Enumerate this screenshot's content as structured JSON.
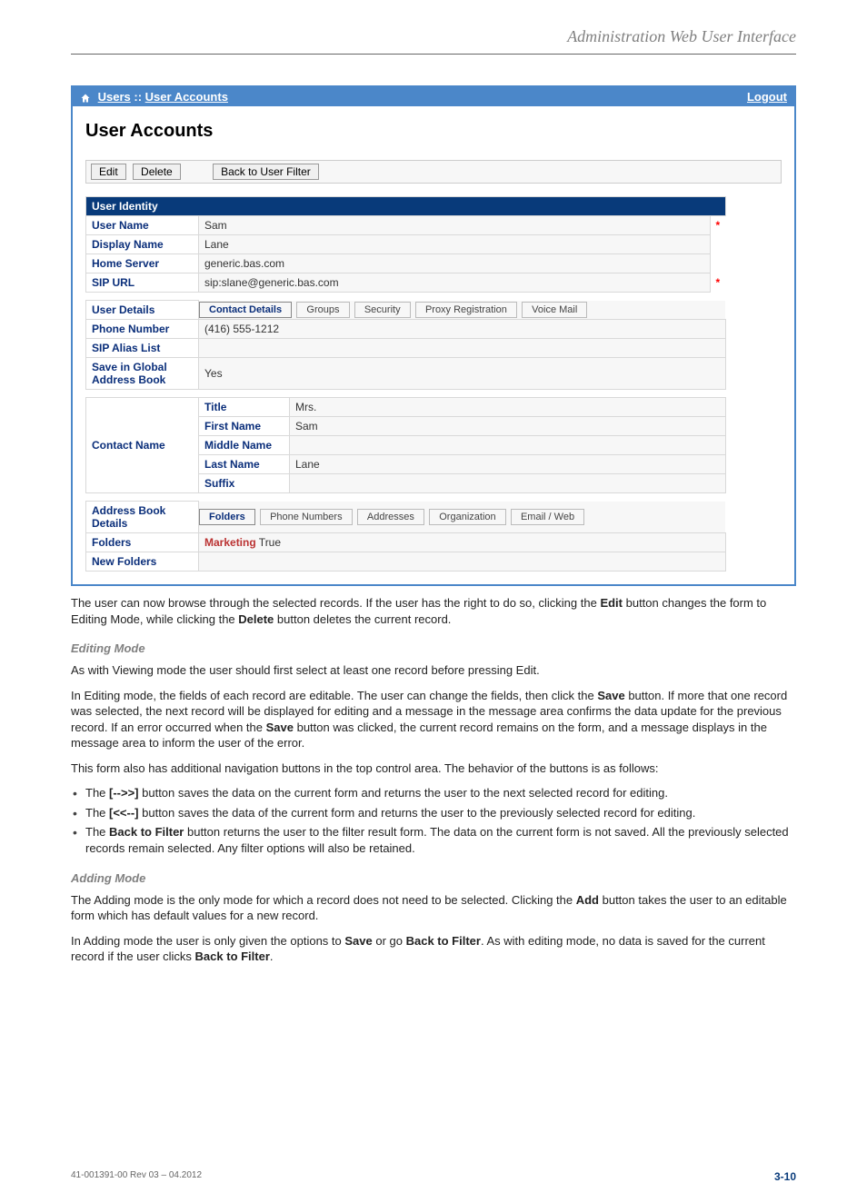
{
  "header": {
    "title": "Administration Web User Interface"
  },
  "breadcrumb": {
    "users_link": "Users",
    "sep": " :: ",
    "accounts_link": "User Accounts",
    "logout": "Logout"
  },
  "page_title": "User Accounts",
  "toolbar": {
    "edit": "Edit",
    "delete": "Delete",
    "back": "Back to User Filter"
  },
  "identity": {
    "section": "User Identity",
    "username_label": "User Name",
    "username": "Sam",
    "display_label": "Display Name",
    "display": "Lane",
    "home_label": "Home Server",
    "home": "generic.bas.com",
    "sip_label": "SIP URL",
    "sip": "sip:slane@generic.bas.com",
    "req": "*"
  },
  "details": {
    "label": "User Details",
    "tabs": {
      "contact": "Contact Details",
      "groups": "Groups",
      "security": "Security",
      "proxy": "Proxy Registration",
      "voicemail": "Voice Mail"
    },
    "phone_label": "Phone Number",
    "phone": "(416) 555-1212",
    "alias_label": "SIP Alias List",
    "save_label": "Save in Global Address Book",
    "save_val": "Yes",
    "contact_label": "Contact Name",
    "title_label": "Title",
    "title_val": "Mrs.",
    "first_label": "First Name",
    "first_val": "Sam",
    "middle_label": "Middle Name",
    "middle_val": "",
    "last_label": "Last Name",
    "last_val": "Lane",
    "suffix_label": "Suffix",
    "suffix_val": ""
  },
  "address": {
    "label": "Address Book Details",
    "tabs": {
      "folders": "Folders",
      "phones": "Phone Numbers",
      "addresses": "Addresses",
      "org": "Organization",
      "email": "Email / Web"
    },
    "folders_label": "Folders",
    "marketing": "Marketing",
    "marketing_val": " True",
    "newfolders_label": "New Folders"
  },
  "body": {
    "p1a": "The user can now browse through the selected records. If the user has the right to do so, clicking the ",
    "p1b": "Edit",
    "p1c": " button changes the form to Editing Mode, while clicking the ",
    "p1d": "Delete",
    "p1e": " button deletes the current record.",
    "h1": "Editing Mode",
    "p2": "As with Viewing mode the user should first select at least one record before pressing Edit.",
    "p3a": "In Editing mode, the fields of each record are editable. The user can change the fields, then click the ",
    "p3b": "Save",
    "p3c": " button. If more that one record was selected, the next record will be displayed for editing and a message in the message area confirms the data update for the previous record. If an error occurred when the ",
    "p3d": "Save",
    "p3e": " button was clicked, the current record remains on the form, and a message displays in the message area to inform the user of the error.",
    "p4": "This form also has additional navigation buttons in the top control area. The behavior of the buttons is as follows:",
    "li1a": "The ",
    "li1b": "[-->>]",
    "li1c": " button saves the data on the current form and returns the user to the next selected record for editing.",
    "li2a": "The ",
    "li2b": "[<<--]",
    "li2c": " button saves the data of the current form and returns the user to the previously selected record for editing.",
    "li3a": "The ",
    "li3b": "Back to Filter",
    "li3c": " button returns the user to the filter result form. The data on the current form is not saved. All the previously selected records remain selected. Any filter options will also be retained.",
    "h2": "Adding Mode",
    "p5a": "The Adding mode is the only mode for which a record does not need to be selected. Clicking the ",
    "p5b": "Add",
    "p5c": " button takes the user to an editable form which has default values for a new record.",
    "p6a": "In Adding mode the user is only given the options to ",
    "p6b": "Save",
    "p6c": " or go ",
    "p6d": "Back to Filter",
    "p6e": ". As with editing mode, no data is saved for the current record if the user clicks ",
    "p6f": "Back to Filter",
    "p6g": "."
  },
  "footer": {
    "doc_id": "41-001391-00 Rev 03 – 04.2012",
    "page_no": "3-10"
  }
}
